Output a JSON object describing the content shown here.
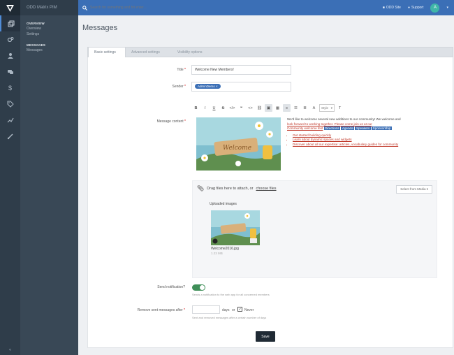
{
  "app": {
    "brand": "ODD Matrix PIM"
  },
  "topbar": {
    "search_placeholder": "Search for something and hit enter...",
    "link1": "ODD Site",
    "link2": "Support",
    "avatar_letter": "A"
  },
  "sidebar": {
    "overview_heading": "OVERVIEW",
    "overview_items": [
      "Overview",
      "Settings"
    ],
    "messages_heading": "MESSAGES",
    "messages_items": [
      "Messages"
    ]
  },
  "page": {
    "title": "Messages"
  },
  "tabs": [
    "Basic settings",
    "Advanced settings",
    "Visibility options"
  ],
  "form": {
    "title_label": "Title",
    "title_value": "Welcome New Members!",
    "sender_label": "Sender",
    "sender_chip": "AdminDemo",
    "content_label": "Message content",
    "toolbar": {
      "bold": "B",
      "italic": "I",
      "underline": "U",
      "strike": "S",
      "style_select": "Style"
    },
    "editor": {
      "line1": "We'd like to welcome several new additions to our community! We welcome and",
      "line2": "look forward to working together. Please come join us at our",
      "line3": "Community welcome fest",
      "tag1": "Directions",
      "tag2": "Agenda",
      "tag3": "Speakers",
      "tag4": "Sponsorship",
      "bullets": [
        "Get started building quickly",
        "Learn about dynamic spaces and widgets",
        "Discover about all our expertise: articles, vocabulary guides for community"
      ]
    },
    "dropzone": {
      "prompt_prefix": "Drag files here to attach, or",
      "prompt_link": "choose files",
      "button": "Select from Media",
      "uploaded_heading": "Uploaded images",
      "file_name": "Welcome2016.jpg",
      "file_size": "1.23 MB"
    },
    "notify_label": "Send notification?",
    "notify_help": "Sends a notification to the web app for all concerned members",
    "remove_label": "Remove sent messages after",
    "remove_unit": "days",
    "remove_or": "or",
    "remove_never": "Never",
    "remove_help": "Sent and removed messages after a certain number of days",
    "save_button": "Save"
  },
  "colors": {
    "header_blue": "#3b6fb6",
    "sidebar_dark": "#394856",
    "rail_dark": "#2f3d4a",
    "toggle_green": "#3f8f59"
  }
}
